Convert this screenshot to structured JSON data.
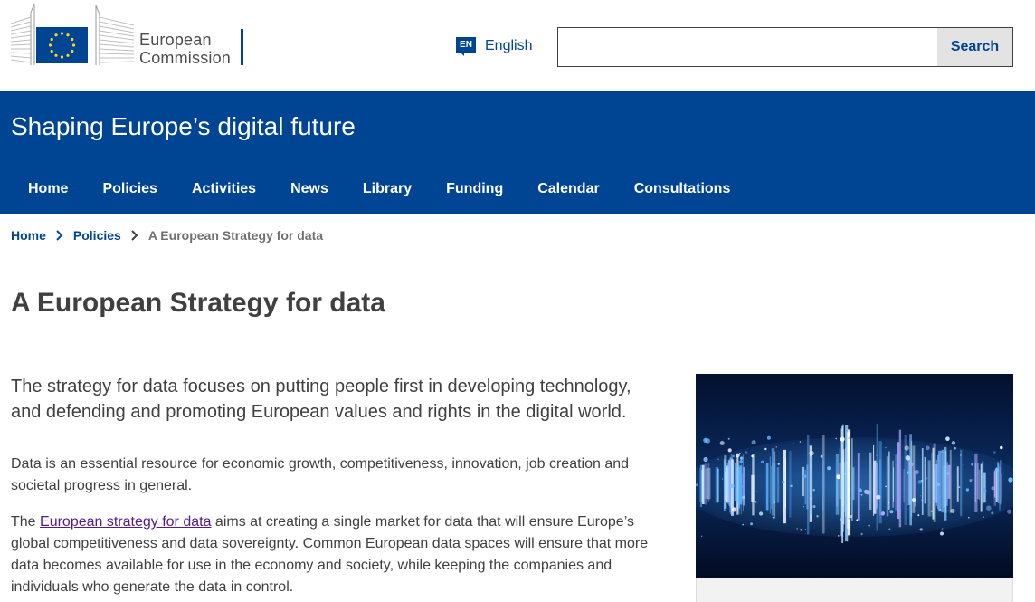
{
  "header": {
    "logo": {
      "line1": "European",
      "line2": "Commission",
      "icon": "eu-flag-icon"
    },
    "language": {
      "code": "EN",
      "label": "English",
      "icon": "language-icon"
    },
    "search": {
      "value": "",
      "placeholder": "",
      "button_label": "Search"
    }
  },
  "banner": {
    "site_title": "Shaping Europe’s digital future",
    "nav": [
      {
        "label": "Home"
      },
      {
        "label": "Policies"
      },
      {
        "label": "Activities"
      },
      {
        "label": "News"
      },
      {
        "label": "Library"
      },
      {
        "label": "Funding"
      },
      {
        "label": "Calendar"
      },
      {
        "label": "Consultations"
      }
    ]
  },
  "breadcrumb": {
    "items": [
      {
        "label": "Home"
      },
      {
        "label": "Policies"
      }
    ],
    "current": "A European Strategy for data",
    "separator_icon": "chevron-right-icon"
  },
  "main": {
    "title": "A European Strategy for data",
    "lead": "The strategy for data focuses on putting people first in developing technology, and defending and promoting European values and rights in the digital world.",
    "paragraph1": "Data is an essential resource for economic growth, competitiveness, innovation, job creation and societal progress in general.",
    "paragraph2": {
      "before": "The ",
      "link": "European strategy for data",
      "after": " aims at creating a single market for data that will ensure Europe’s global competitiveness and data sovereignty. Common European data spaces will ensure that more data becomes available for use in the economy and society, while keeping the companies and individuals who generate the data in control."
    },
    "image": {
      "icon": "data-visualization-image"
    }
  },
  "colors": {
    "brand_blue": "#004494",
    "text": "#404040",
    "muted": "#707070",
    "flag_gold": "#ffd617",
    "link_visited": "#551a8b"
  }
}
